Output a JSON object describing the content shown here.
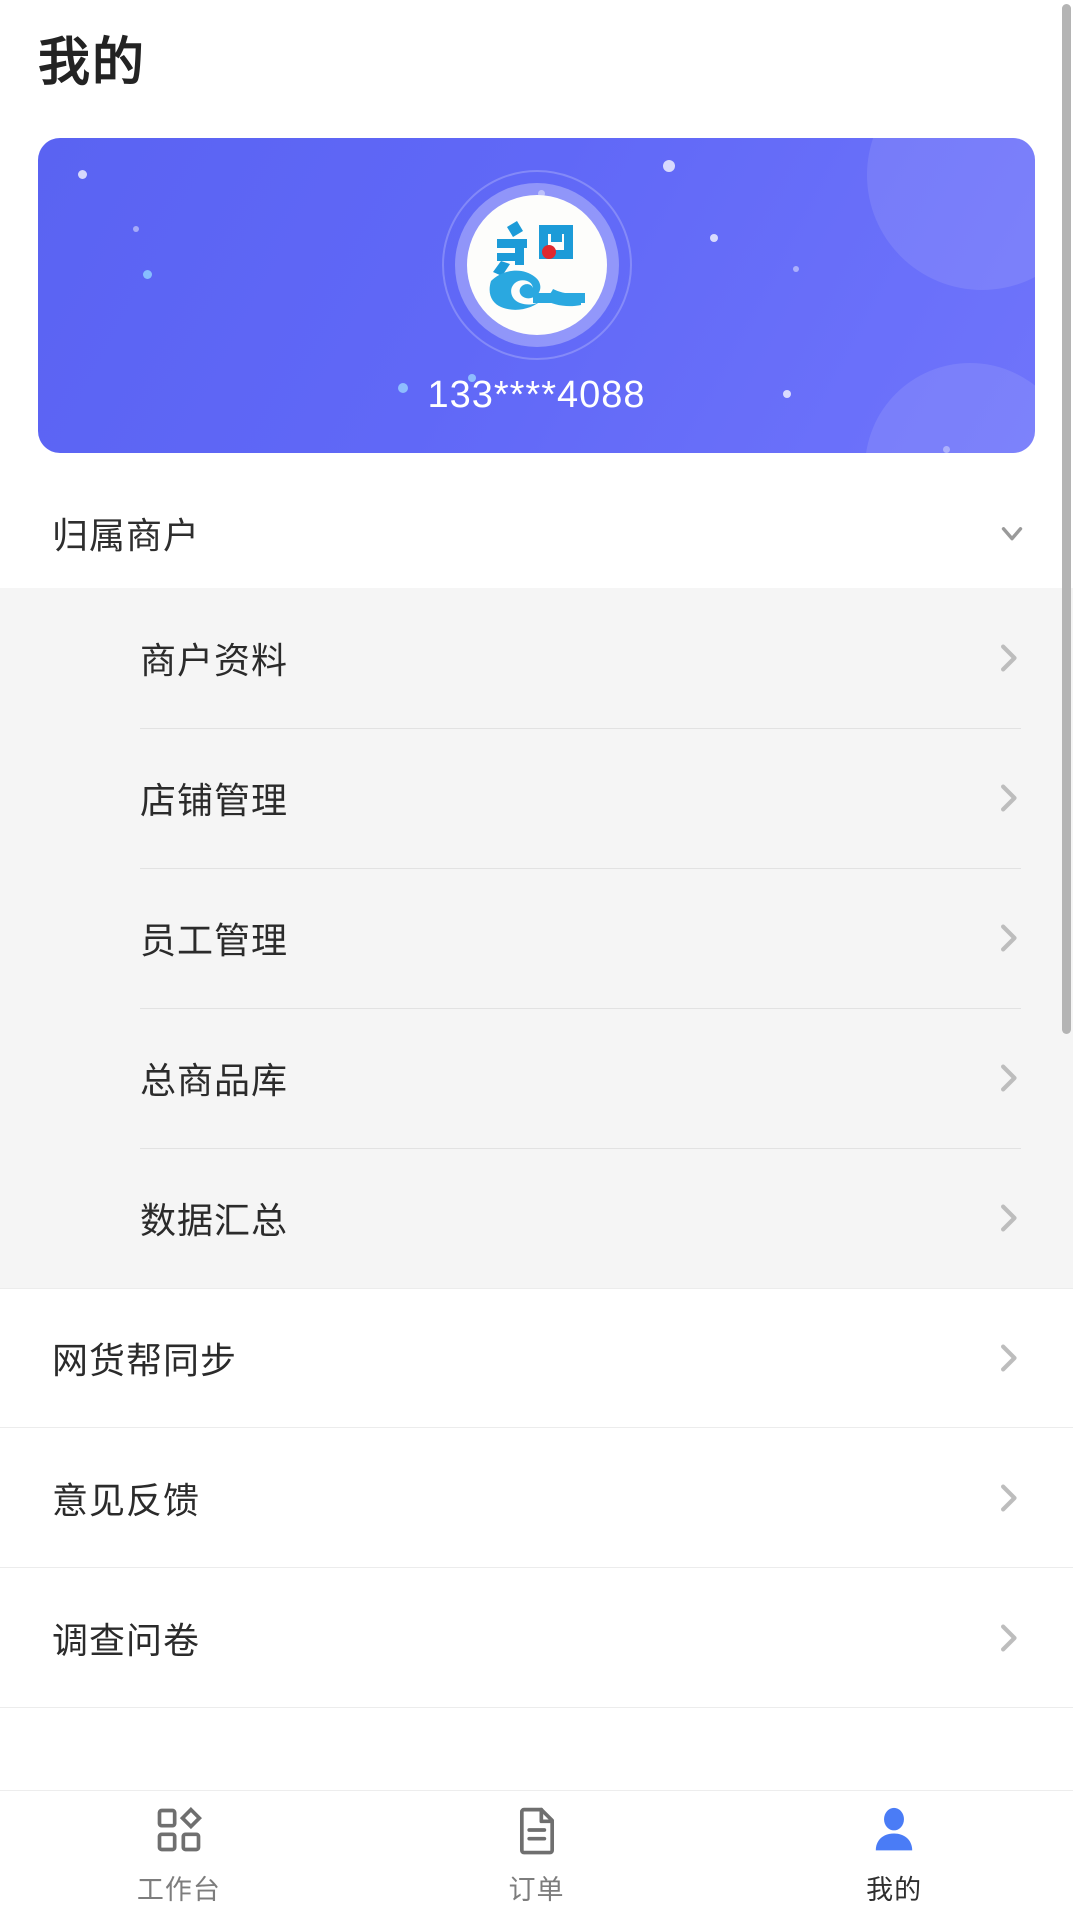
{
  "page": {
    "title": "我的"
  },
  "profile": {
    "phone": "133****4088",
    "avatar_icon": "zhi-logo-avatar",
    "card_color": "#5d65f5",
    "card_color_end": "#7075fb"
  },
  "merchant_section": {
    "header_label": "归属商户",
    "expand_icon": "chevron-down-icon",
    "expanded": true,
    "items": [
      {
        "label": "商户资料",
        "chevron": "chevron-right-icon"
      },
      {
        "label": "店铺管理",
        "chevron": "chevron-right-icon"
      },
      {
        "label": "员工管理",
        "chevron": "chevron-right-icon"
      },
      {
        "label": "总商品库",
        "chevron": "chevron-right-icon"
      },
      {
        "label": "数据汇总",
        "chevron": "chevron-right-icon"
      }
    ]
  },
  "other_items": [
    {
      "label": "网货帮同步",
      "chevron": "chevron-right-icon"
    },
    {
      "label": "意见反馈",
      "chevron": "chevron-right-icon"
    },
    {
      "label": "调查问卷",
      "chevron": "chevron-right-icon"
    }
  ],
  "tab_bar": {
    "active_color": "#4a7cf6",
    "inactive_color": "#7d7d7d",
    "tabs": [
      {
        "label": "工作台",
        "icon": "workbench-grid-icon",
        "active": false
      },
      {
        "label": "订单",
        "icon": "order-document-icon",
        "active": false
      },
      {
        "label": "我的",
        "icon": "profile-person-icon",
        "active": true
      }
    ]
  },
  "scrollbar": {
    "visible": true,
    "color": "#b4b4b4"
  }
}
